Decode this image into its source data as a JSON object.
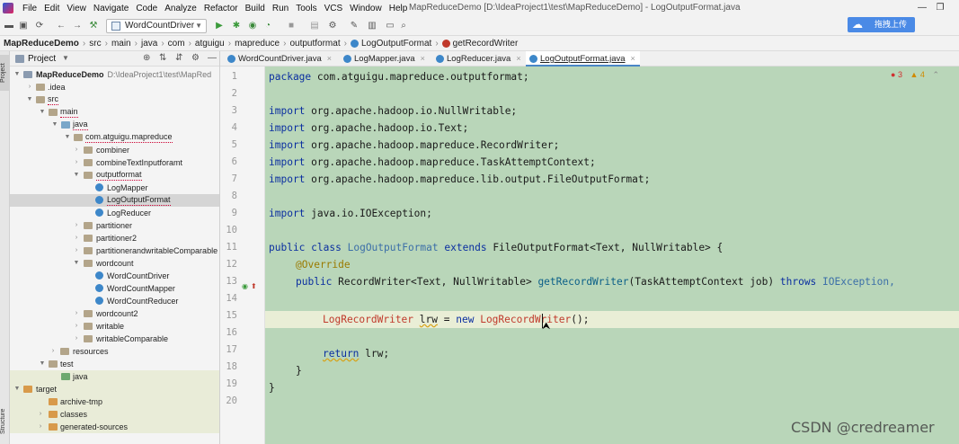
{
  "menu": [
    "File",
    "Edit",
    "View",
    "Navigate",
    "Code",
    "Analyze",
    "Refactor",
    "Build",
    "Run",
    "Tools",
    "VCS",
    "Window",
    "Help"
  ],
  "window_title": "MapReduceDemo [D:\\IdeaProject1\\test\\MapReduceDemo] - LogOutputFormat.java",
  "window_controls": {
    "minimize": "—",
    "restore": "❐"
  },
  "toolbar": {
    "run_config": "WordCountDriver",
    "upload_label": "拖拽上传"
  },
  "breadcrumb": [
    "MapReduceDemo",
    "src",
    "main",
    "java",
    "com",
    "atguigu",
    "mapreduce",
    "outputformat",
    "LogOutputFormat",
    "getRecordWriter"
  ],
  "project_panel": {
    "title": "Project",
    "tree": [
      {
        "label": "MapReduceDemo",
        "path": "D:\\IdeaProject1\\test\\MapRed",
        "bold": true
      },
      {
        "label": ".idea"
      },
      {
        "label": "src"
      },
      {
        "label": "main"
      },
      {
        "label": "java"
      },
      {
        "label": "com.atguigu.mapreduce"
      },
      {
        "label": "combiner"
      },
      {
        "label": "combineTextInputforamt"
      },
      {
        "label": "outputformat"
      },
      {
        "label": "LogMapper"
      },
      {
        "label": "LogOutputFormat"
      },
      {
        "label": "LogReducer"
      },
      {
        "label": "partitioner"
      },
      {
        "label": "partitioner2"
      },
      {
        "label": "partitionerandwritableComparable"
      },
      {
        "label": "wordcount"
      },
      {
        "label": "WordCountDriver"
      },
      {
        "label": "WordCountMapper"
      },
      {
        "label": "WordCountReducer"
      },
      {
        "label": "wordcount2"
      },
      {
        "label": "writable"
      },
      {
        "label": "writableComparable"
      },
      {
        "label": "resources"
      },
      {
        "label": "test"
      },
      {
        "label": "java"
      },
      {
        "label": "target"
      },
      {
        "label": "archive-tmp"
      },
      {
        "label": "classes"
      },
      {
        "label": "generated-sources"
      }
    ]
  },
  "side_strip": {
    "top_label": "Project",
    "bottom_label": "Structure"
  },
  "tabs": [
    "WordCountDriver.java",
    "LogMapper.java",
    "LogReducer.java",
    "LogOutputFormat.java"
  ],
  "active_tab": "LogOutputFormat.java",
  "inspection": {
    "errors": "3",
    "warnings": "4"
  },
  "line_numbers": [
    "1",
    "2",
    "3",
    "4",
    "5",
    "6",
    "7",
    "8",
    "9",
    "10",
    "11",
    "12",
    "13",
    "14",
    "15",
    "16",
    "17",
    "18",
    "19",
    "20"
  ],
  "code": {
    "l1_kw": "package",
    "l1_rest": " com.atguigu.mapreduce.outputformat;",
    "import_kw": "import",
    "l3": " org.apache.hadoop.io.NullWritable;",
    "l4": " org.apache.hadoop.io.Text;",
    "l5": " org.apache.hadoop.mapreduce.RecordWriter;",
    "l6": " org.apache.hadoop.mapreduce.TaskAttemptContext;",
    "l7": " org.apache.hadoop.mapreduce.lib.output.FileOutputFormat;",
    "l9": " java.io.IOException;",
    "l11_kw1": "public",
    "l11_kw2": "class",
    "l11_cls": "LogOutputFormat",
    "l11_kw3": "extends",
    "l11_rest": "FileOutputFormat<Text, NullWritable> {",
    "l12": "@Override",
    "l13_kw": "public",
    "l13_mid": " RecordWriter<Text, NullWritable> ",
    "l13_fn": "getRecordWriter",
    "l13_args": "(TaskAttemptContext job) ",
    "l13_kw2": "throws",
    "l13_tail": " IOException,",
    "l15_cls1": "LogRecordWriter",
    "l15_var": "lrw",
    "l15_eq": " = ",
    "l15_kw": "new",
    "l15_cls2": "LogRecordWriter",
    "l15_end": "();",
    "l17_kw": "return",
    "l17_rest": " lrw;",
    "l18": "}",
    "l19": "}"
  },
  "watermark": "CSDN @credreamer"
}
